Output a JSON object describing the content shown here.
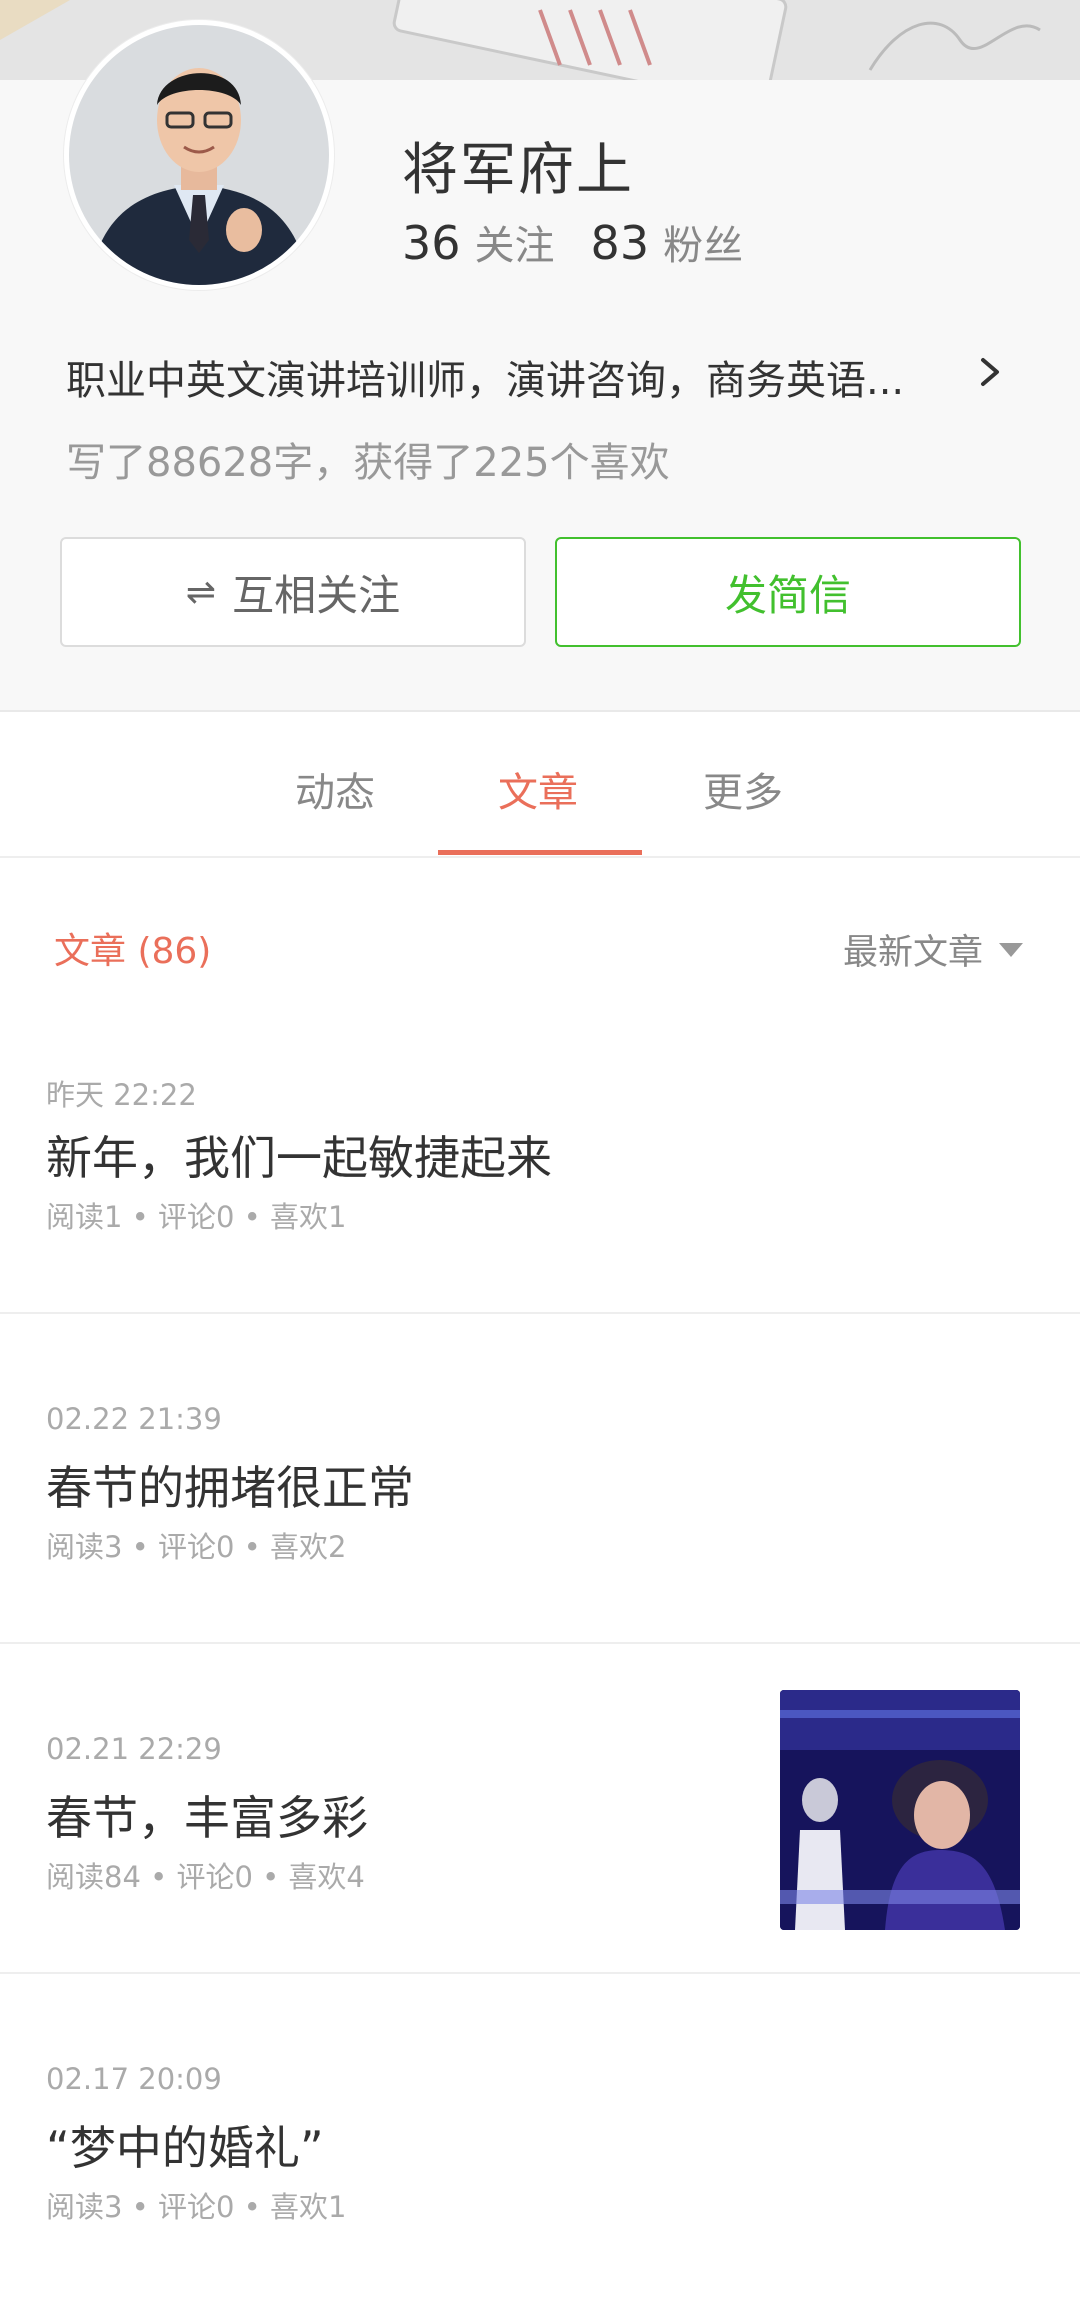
{
  "profile": {
    "username": "将军府上",
    "following_count": "36",
    "following_label": "关注",
    "followers_count": "83",
    "followers_label": "粉丝",
    "bio": "职业中英文演讲培训师，演讲咨询，商务英语...",
    "wordcount_text": "写了88628字，获得了225个喜欢",
    "follow_button_icon": "⇌",
    "follow_button_label": "互相关注",
    "message_button_label": "发简信"
  },
  "tabs": [
    {
      "label": "动态",
      "active": false
    },
    {
      "label": "文章",
      "active": true
    },
    {
      "label": "更多",
      "active": false
    }
  ],
  "list": {
    "title": "文章 (86)",
    "sort_label": "最新文章"
  },
  "articles": [
    {
      "date": "昨天 22:22",
      "title": "新年，我们一起敏捷起来",
      "meta": "阅读1 • 评论0 • 喜欢1",
      "has_thumb": false
    },
    {
      "date": "02.22 21:39",
      "title": "春节的拥堵很正常",
      "meta": "阅读3 • 评论0 • 喜欢2",
      "has_thumb": false
    },
    {
      "date": "02.21 22:29",
      "title": "春节，丰富多彩",
      "meta": "阅读84 • 评论0 • 喜欢4",
      "has_thumb": true
    },
    {
      "date": "02.17 20:09",
      "title": "“梦中的婚礼”",
      "meta": "阅读3 • 评论0 • 喜欢1",
      "has_thumb": false
    }
  ],
  "colors": {
    "accent": "#ea6f5a",
    "message_green": "#42c02e",
    "text_primary": "#333333",
    "text_muted": "#aaaaaa"
  },
  "icons": {
    "bio_expand": "chevron-right-icon",
    "follow_state": "mutual-follow-icon",
    "sort": "triangle-down-icon"
  }
}
